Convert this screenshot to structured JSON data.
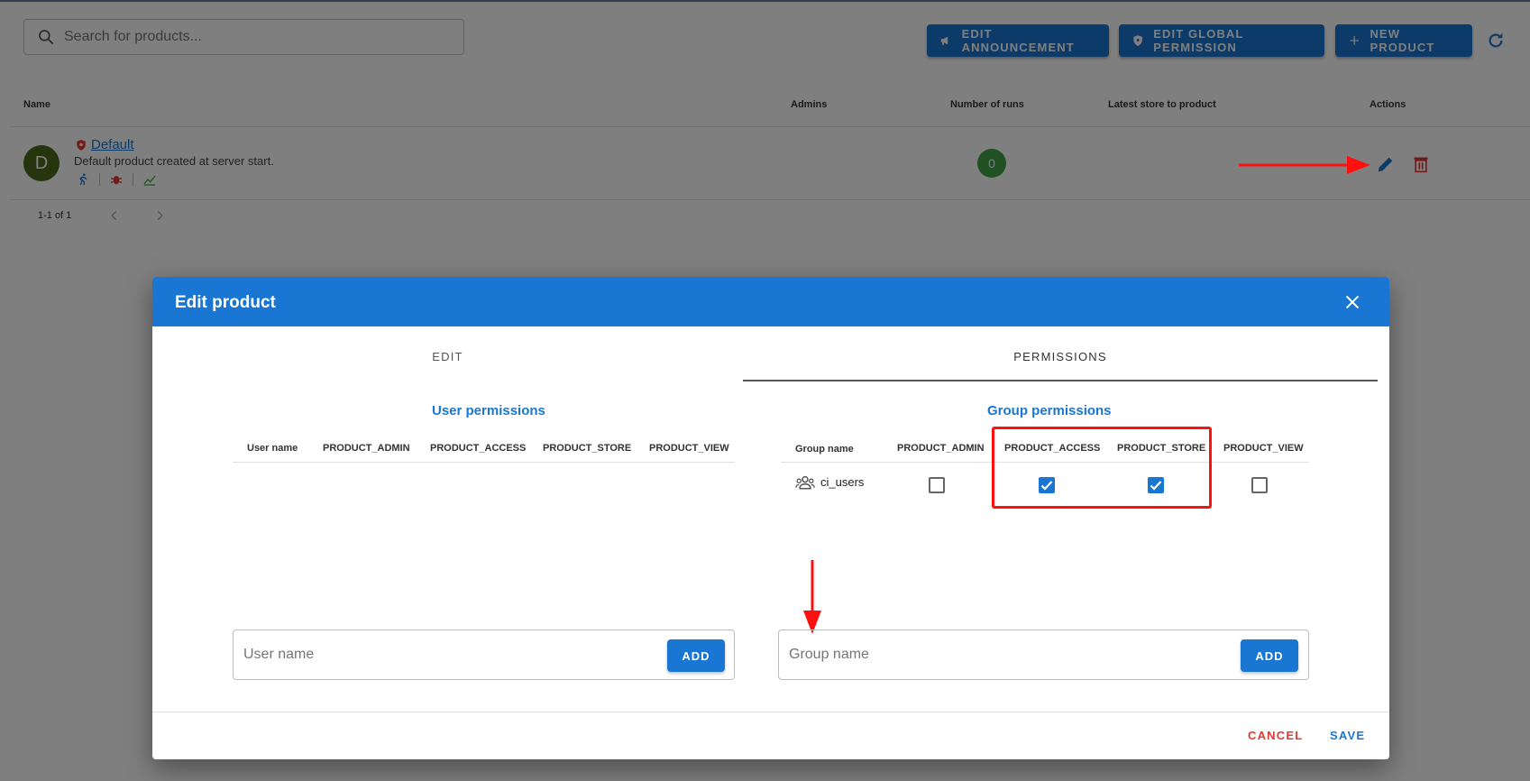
{
  "search": {
    "placeholder": "Search for products..."
  },
  "header_buttons": {
    "announcement": "EDIT ANNOUNCEMENT",
    "global_permission": "EDIT GLOBAL PERMISSION",
    "new_product": "NEW PRODUCT"
  },
  "table": {
    "columns": [
      "Name",
      "Admins",
      "Number of runs",
      "Latest store to product",
      "Actions"
    ],
    "rows": [
      {
        "avatar": "D",
        "name": "Default",
        "description": "Default product created at server start.",
        "runs": "0"
      }
    ],
    "pagination": "1-1 of 1"
  },
  "dialog": {
    "title": "Edit product",
    "tabs": [
      "EDIT",
      "PERMISSIONS"
    ],
    "active_tab": "PERMISSIONS",
    "user_permissions": {
      "title": "User permissions",
      "columns": [
        "User name",
        "PRODUCT_ADMIN",
        "PRODUCT_ACCESS",
        "PRODUCT_STORE",
        "PRODUCT_VIEW"
      ],
      "input_placeholder": "User name",
      "add_label": "ADD"
    },
    "group_permissions": {
      "title": "Group permissions",
      "columns": [
        "Group name",
        "PRODUCT_ADMIN",
        "PRODUCT_ACCESS",
        "PRODUCT_STORE",
        "PRODUCT_VIEW"
      ],
      "rows": [
        {
          "name": "ci_users",
          "product_admin": false,
          "product_access": true,
          "product_store": true,
          "product_view": false
        }
      ],
      "input_placeholder": "Group name",
      "add_label": "ADD"
    },
    "cancel_label": "CANCEL",
    "save_label": "SAVE"
  },
  "colors": {
    "primary": "#1976d2",
    "danger": "#e53935",
    "success": "#43a047",
    "annotation": "#ff1010"
  }
}
